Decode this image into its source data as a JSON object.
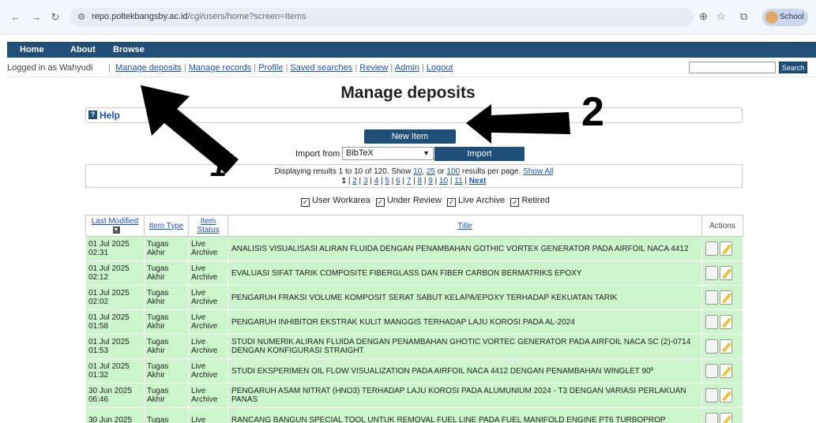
{
  "browser": {
    "url_host": "repo.poltekbangsby.ac.id",
    "url_path": "/cgi/users/home?screen=Items",
    "profile_label": "School"
  },
  "nav": {
    "home": "Home",
    "about": "About",
    "browse": "Browse"
  },
  "userbar": {
    "logged_in": "Logged in as Wahyudi",
    "links": [
      "Manage deposits",
      "Manage records",
      "Profile",
      "Saved searches",
      "Review",
      "Admin",
      "Logout"
    ],
    "search_button": "Search"
  },
  "page_title": "Manage deposits",
  "help_label": "Help",
  "new_item_label": "New Item",
  "import": {
    "label": "Import from",
    "selected": "BibTeX",
    "button": "Import"
  },
  "results": {
    "text_prefix": "Displaying results 1 to 10 of 120. Show",
    "show_10": "10",
    "show_25": "25",
    "text_or": "or",
    "show_100": "100",
    "text_suffix": "results per page.",
    "show_all": "Show All",
    "current_page": "1",
    "pages": [
      "2",
      "3",
      "4",
      "5",
      "6",
      "7",
      "8",
      "9",
      "10",
      "11"
    ],
    "next": "Next"
  },
  "filters": [
    "User Workarea",
    "Under Review",
    "Live Archive",
    "Retired"
  ],
  "table": {
    "headers": {
      "last_modified": "Last Modified",
      "item_type": "Item Type",
      "item_status": "Item Status",
      "title": "Title",
      "actions": "Actions"
    },
    "rows": [
      {
        "date": "01 Jul 2025 02:31",
        "type": "Tugas Akhir",
        "status": "Live Archive",
        "title": "ANALISIS VISUALISASI ALIRAN FLUIDA DENGAN PENAMBAHAN GOTHIC VORTEX GENERATOR PADA AIRFOIL NACA 4412"
      },
      {
        "date": "01 Jul 2025 02:12",
        "type": "Tugas Akhir",
        "status": "Live Archive",
        "title": "EVALUASI SIFAT TARIK COMPOSITE FIBERGLASS DAN FIBER CARBON BERMATRIKS EPOXY"
      },
      {
        "date": "01 Jul 2025 02:02",
        "type": "Tugas Akhir",
        "status": "Live Archive",
        "title": "PENGARUH FRAKSI VOLUME KOMPOSIT SERAT SABUT KELAPA/EPOXY TERHADAP KEKUATAN TARIK"
      },
      {
        "date": "01 Jul 2025 01:58",
        "type": "Tugas Akhir",
        "status": "Live Archive",
        "title": "PENGARUH INHIBITOR EKSTRAK KULIT MANGGIS TERHADAP LAJU KOROSI PADA AL-2024"
      },
      {
        "date": "01 Jul 2025 01:53",
        "type": "Tugas Akhir",
        "status": "Live Archive",
        "title": "STUDI NUMERIK ALIRAN FLUIDA DENGAN PENAMBAHAN GHOTIC VORTEC GENERATOR PADA AIRFOIL NACA SC (2)-0714 DENGAN KONFIGURASI STRAIGHT"
      },
      {
        "date": "01 Jul 2025 01:32",
        "type": "Tugas Akhir",
        "status": "Live Archive",
        "title": "STUDI EKSPERIMEN OIL FLOW VISUALIZATION PADA AIRFOIL NACA 4412 DENGAN PENAMBAHAN WINGLET 90º"
      },
      {
        "date": "30 Jun 2025 06:46",
        "type": "Tugas Akhir",
        "status": "Live Archive",
        "title": "PENGARUH ASAM NITRAT (HNO3) TERHADAP LAJU KOROSI PADA ALUMUNIUM 2024 - T3 DENGAN VARIASI PERLAKUAN PANAS"
      },
      {
        "date": "30 Jun 2025",
        "type": "Tugas",
        "status": "Live",
        "title": "RANCANG BANGUN SPECIAL TOOL UNTUK REMOVAL FUEL LINE PADA FUEL MANIFOLD ENGINE PT6 TURBOPROP"
      }
    ]
  },
  "annotations": {
    "label_1": "1",
    "label_2": "2"
  }
}
